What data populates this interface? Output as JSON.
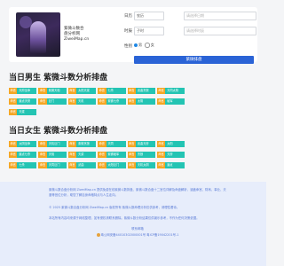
{
  "site": {
    "name_line1": "紫微斗数合",
    "name_line2": "盘分析网",
    "name_line3": "ZiweiMap.cn"
  },
  "form": {
    "birthday_label": "日历",
    "birthday_select": "农历",
    "calendar_placeholder": "请选择日期",
    "time_label": "时辰",
    "time_select": "子时",
    "time_placeholder": "请选择时辰",
    "gender_label": "性别",
    "gender_male": "男",
    "gender_female": "女",
    "submit_label": "紫微排盘"
  },
  "male_section": {
    "title": "当日男生 紫微斗数分析排盘",
    "tags": [
      {
        "a": "命宫",
        "b": "天府坐命"
      },
      {
        "a": "命宫",
        "b": "紫微天相"
      },
      {
        "a": "命宫",
        "b": "太阳天梁"
      },
      {
        "a": "命宫",
        "b": "七杀"
      },
      {
        "a": "命宫",
        "b": "武曲贪狼"
      },
      {
        "a": "命宫",
        "b": "天同太阴"
      },
      {
        "a": "命宫",
        "b": "廉贞天府"
      },
      {
        "a": "命宫",
        "b": "巨门"
      },
      {
        "a": "命宫",
        "b": "天机"
      },
      {
        "a": "命宫",
        "b": "紫微七杀"
      },
      {
        "a": "命宫",
        "b": "太阴"
      },
      {
        "a": "命宫",
        "b": "破军"
      },
      {
        "a": "命宫",
        "b": "天梁"
      }
    ]
  },
  "female_section": {
    "title": "当日女生 紫微斗数分析排盘",
    "tags": [
      {
        "a": "命宫",
        "b": "太阴坐命"
      },
      {
        "a": "命宫",
        "b": "天机巨门"
      },
      {
        "a": "命宫",
        "b": "紫微贪狼"
      },
      {
        "a": "命宫",
        "b": "天同"
      },
      {
        "a": "命宫",
        "b": "武曲天府"
      },
      {
        "a": "命宫",
        "b": "太阳"
      },
      {
        "a": "命宫",
        "b": "廉贞七杀"
      },
      {
        "a": "命宫",
        "b": "天相"
      },
      {
        "a": "命宫",
        "b": "天梁"
      },
      {
        "a": "命宫",
        "b": "紫微破军"
      },
      {
        "a": "命宫",
        "b": "贪狼"
      },
      {
        "a": "命宫",
        "b": "天府"
      },
      {
        "a": "命宫",
        "b": "七杀"
      },
      {
        "a": "命宫",
        "b": "天同巨门"
      },
      {
        "a": "命宫",
        "b": "武曲"
      },
      {
        "a": "命宫",
        "b": "太阳巨门"
      },
      {
        "a": "命宫",
        "b": "天机太阴"
      },
      {
        "a": "命宫",
        "b": "廉贞"
      }
    ]
  },
  "footer": {
    "intro": "紫微斗数合盘分析网 ZiweiMap.cn 提供免费在线紫微斗数排盘、紫微斗数合盘十二宫位详解及命盘解析，涵盖命宫、财帛、事业、夫妻等宫位分析，助您了解自身命格特点与人生走向。",
    "copyright": "© 2025 紫微斗数合盘分析网 ZiweiMap.cn 版权所有 紫微斗数命理分析仅供参考，请理性看待。",
    "notice": "本站所有内容均来源于网络整理，如有侵权请联系删除。紫微斗数分析结果仅供娱乐参考，不作为任何决策依据。",
    "contact": "联系邮箱",
    "icp": "粤公网安备44010302000001号 粤ICP备19042201号-1"
  }
}
